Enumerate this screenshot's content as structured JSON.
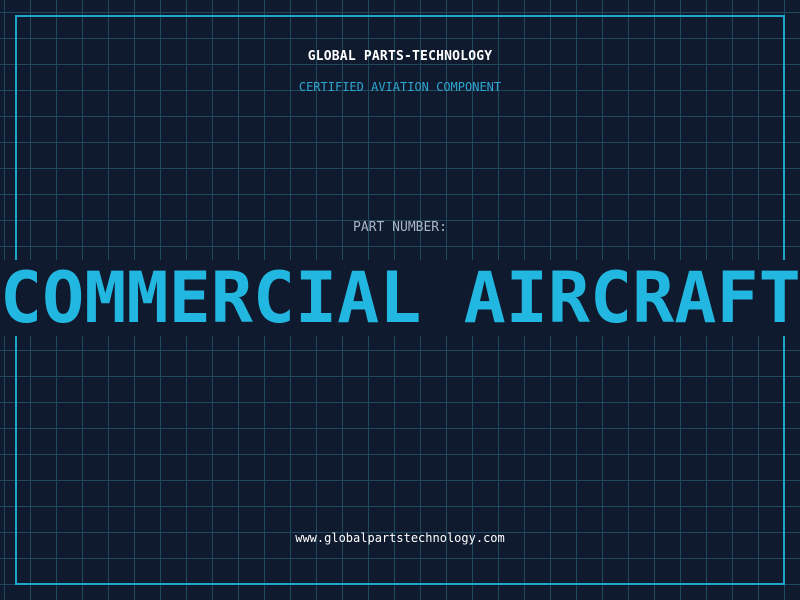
{
  "header": {
    "company": "GLOBAL PARTS-TECHNOLOGY",
    "certification": "CERTIFIED AVIATION COMPONENT"
  },
  "part": {
    "label": "PART NUMBER:",
    "name": "COMMERCIAL AIRCRAFT RADAR SYSTEM"
  },
  "footer": {
    "website": "www.globalpartstechnology.com"
  },
  "colors": {
    "background": "#101a2e",
    "grid": "#1f4a5e",
    "frame": "#1aa7c9",
    "accent": "#22b7e0"
  }
}
